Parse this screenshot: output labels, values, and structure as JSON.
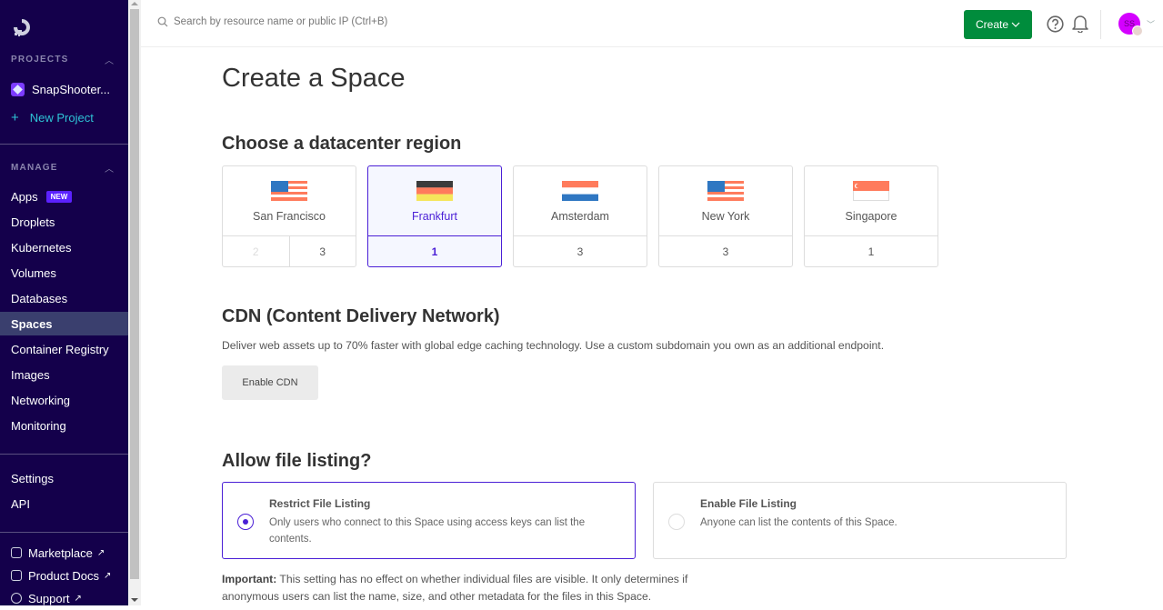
{
  "sidebar": {
    "projects_heading": "PROJECTS",
    "project_name": "SnapShooter...",
    "new_project": "New Project",
    "manage_heading": "MANAGE",
    "items": [
      {
        "label": "Apps",
        "badge": "NEW"
      },
      {
        "label": "Droplets"
      },
      {
        "label": "Kubernetes"
      },
      {
        "label": "Volumes"
      },
      {
        "label": "Databases"
      },
      {
        "label": "Spaces",
        "active": true
      },
      {
        "label": "Container Registry"
      },
      {
        "label": "Images"
      },
      {
        "label": "Networking"
      },
      {
        "label": "Monitoring"
      }
    ],
    "account_items": [
      {
        "label": "Settings"
      },
      {
        "label": "API"
      }
    ],
    "external_links": [
      {
        "label": "Marketplace",
        "icon": "cube-icon"
      },
      {
        "label": "Product Docs",
        "icon": "stack-icon"
      },
      {
        "label": "Support",
        "icon": "lifebuoy-icon"
      }
    ],
    "external_arrow": "↗"
  },
  "topbar": {
    "search_placeholder": "Search by resource name or public IP (Ctrl+B)",
    "create_label": "Create",
    "avatar_initials": "SS"
  },
  "page": {
    "title": "Create a Space",
    "region_heading": "Choose a datacenter region",
    "regions": [
      {
        "name": "San Francisco",
        "flag": "us",
        "numbers": [
          "2",
          "3"
        ],
        "disabled": [
          "2"
        ]
      },
      {
        "name": "Frankfurt",
        "flag": "de",
        "numbers": [
          "1"
        ],
        "selected": true
      },
      {
        "name": "Amsterdam",
        "flag": "nl",
        "numbers": [
          "3"
        ]
      },
      {
        "name": "New York",
        "flag": "us",
        "numbers": [
          "3"
        ]
      },
      {
        "name": "Singapore",
        "flag": "sg",
        "numbers": [
          "1"
        ]
      }
    ],
    "cdn_heading": "CDN (Content Delivery Network)",
    "cdn_description": "Deliver web assets up to 70% faster with global edge caching technology. Use a custom subdomain you own as an additional endpoint.",
    "cdn_button": "Enable CDN",
    "listing_heading": "Allow file listing?",
    "listing_options": [
      {
        "title": "Restrict File Listing",
        "description": "Only users who connect to this Space using access keys can list the contents.",
        "selected": true
      },
      {
        "title": "Enable File Listing",
        "description": "Anyone can list the contents of this Space.",
        "selected": false
      }
    ],
    "important_label": "Important:",
    "important_text": " This setting has no effect on whether individual files are visible. It only determines if anonymous users can list the name, size, and other metadata for the files in this Space."
  },
  "colors": {
    "sidebar_bg": "#14004b",
    "accent": "#4a1fd6",
    "create_green": "#008c3c",
    "new_badge": "#5b21ff"
  }
}
